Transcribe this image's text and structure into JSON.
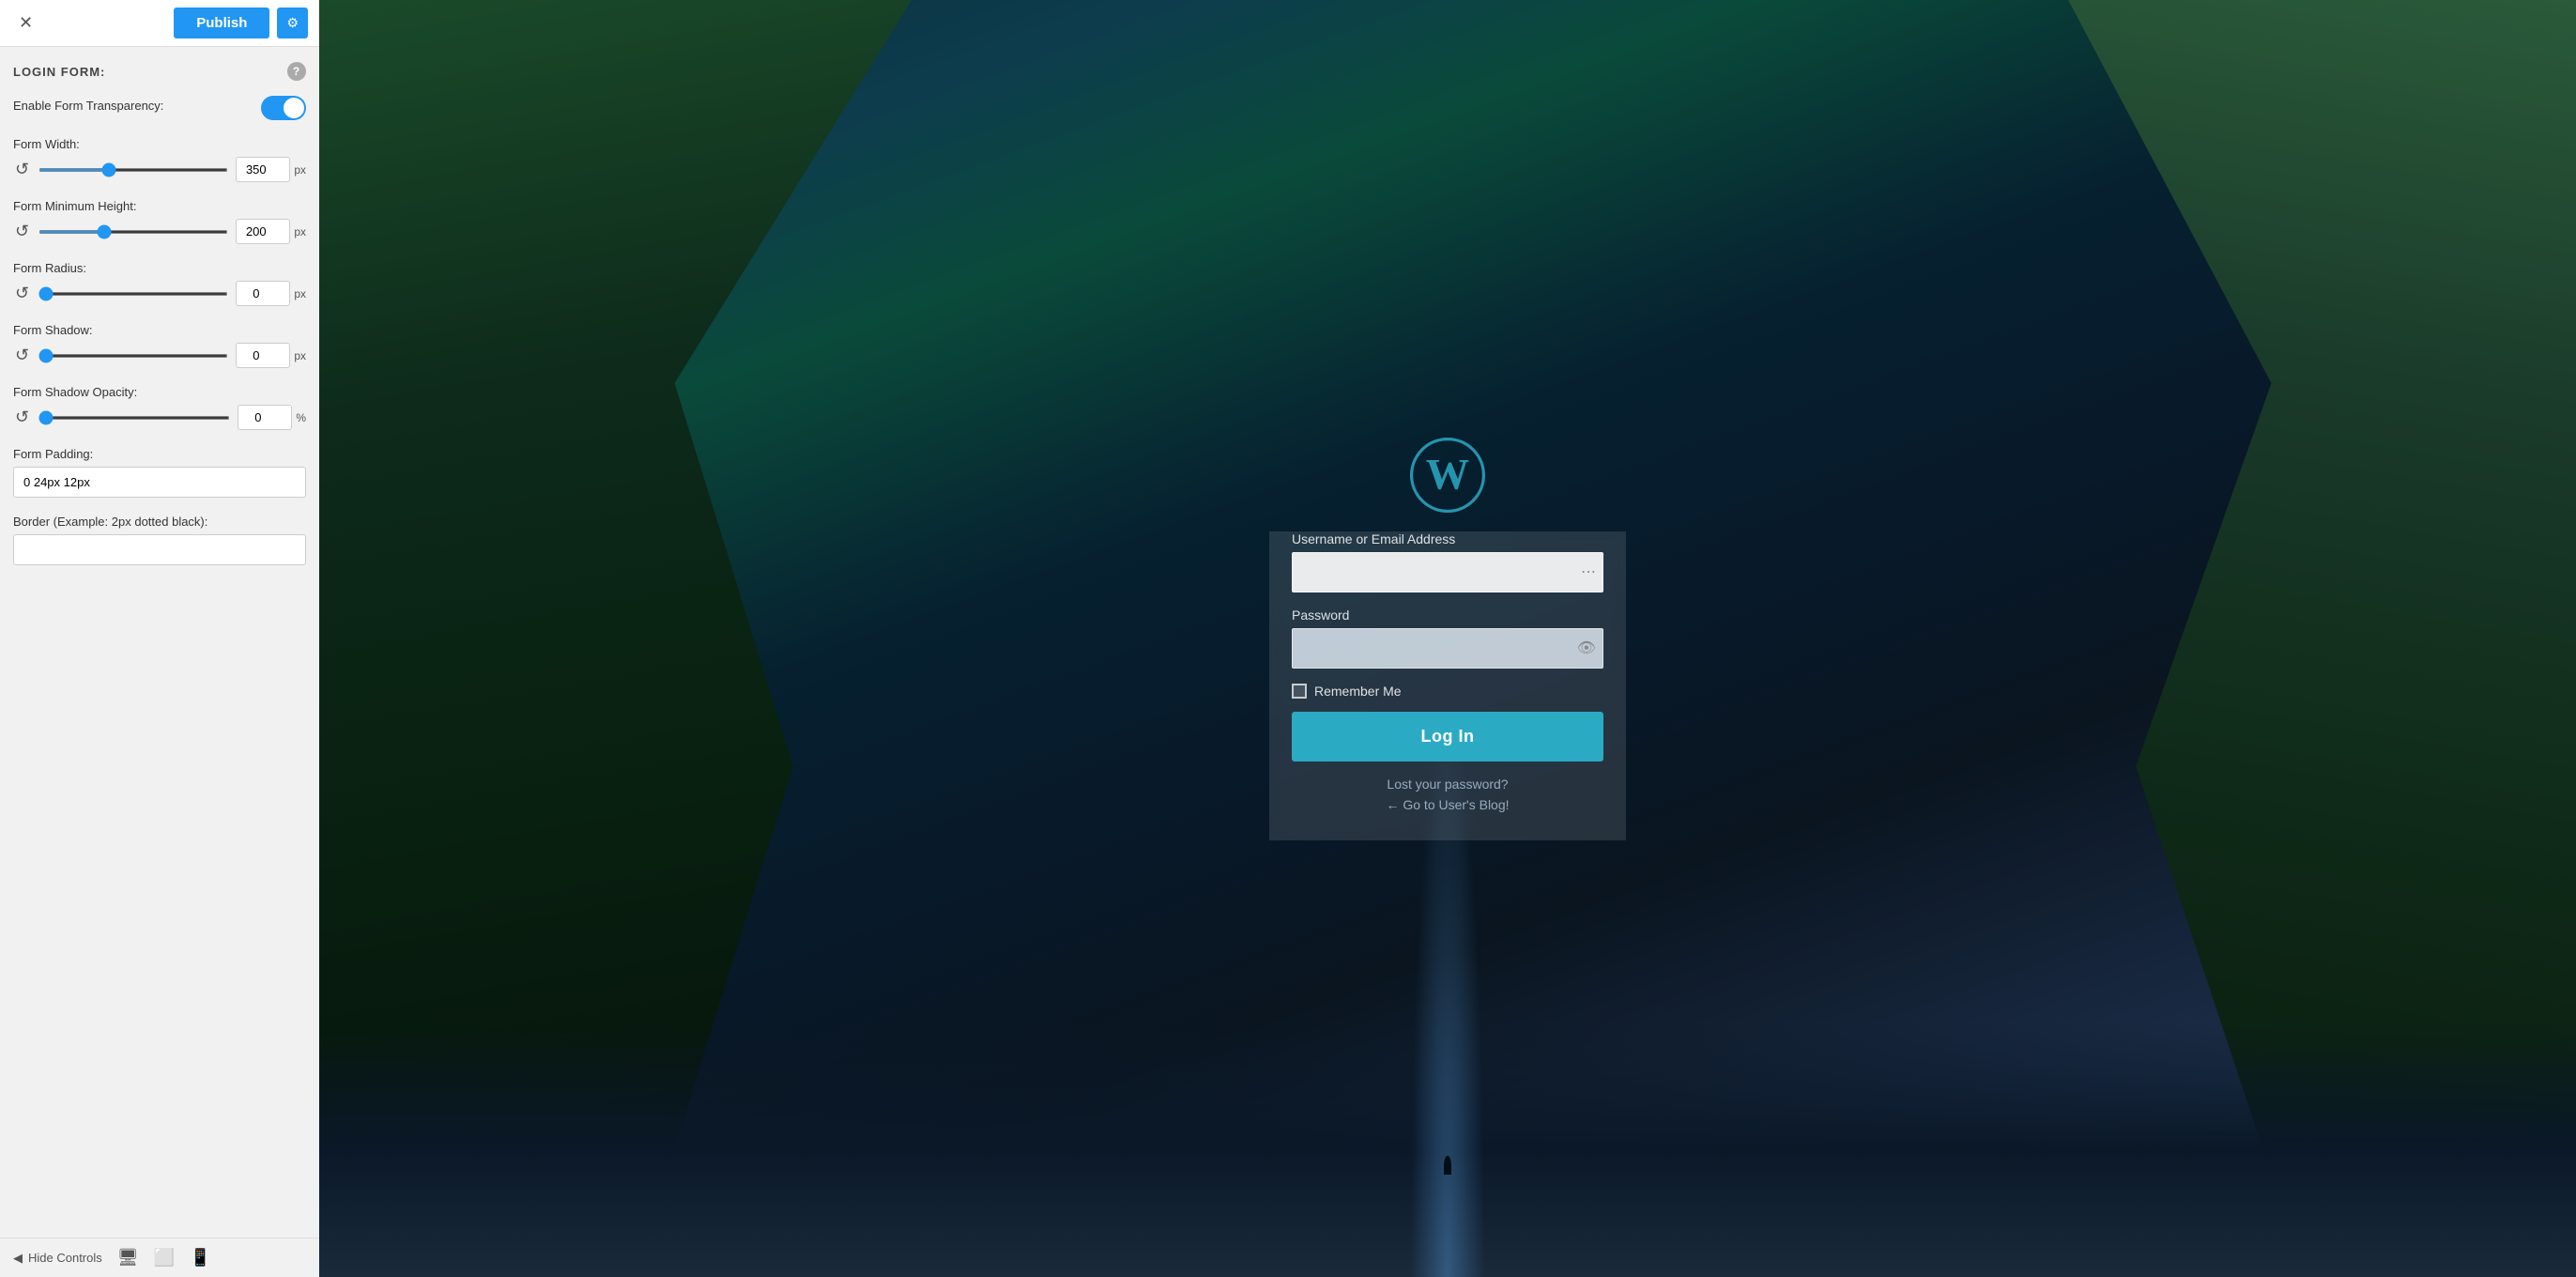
{
  "topbar": {
    "close_label": "✕",
    "publish_label": "Publish",
    "settings_label": "⚙"
  },
  "panel": {
    "section_title": "LOGIN FORM:",
    "help_label": "?",
    "enable_transparency_label": "Enable Form Transparency:",
    "enable_transparency_value": true,
    "form_width_label": "Form Width:",
    "form_width_value": "350",
    "form_width_unit": "px",
    "form_min_height_label": "Form Minimum Height:",
    "form_min_height_value": "200",
    "form_min_height_unit": "px",
    "form_radius_label": "Form Radius:",
    "form_radius_value": "0",
    "form_radius_unit": "px",
    "form_shadow_label": "Form Shadow:",
    "form_shadow_value": "0",
    "form_shadow_unit": "px",
    "form_shadow_opacity_label": "Form Shadow Opacity:",
    "form_shadow_opacity_value": "0",
    "form_shadow_opacity_unit": "%",
    "form_padding_label": "Form Padding:",
    "form_padding_value": "0 24px 12px",
    "border_label": "Border (Example: 2px dotted black):",
    "border_value": ""
  },
  "bottombar": {
    "hide_controls_label": "Hide Controls",
    "desktop_icon": "🖥",
    "tablet_icon": "📱",
    "mobile_icon": "📱"
  },
  "loginform": {
    "username_label": "Username or Email Address",
    "username_placeholder": "",
    "password_label": "Password",
    "password_placeholder": "",
    "remember_label": "Remember Me",
    "login_button": "Log In",
    "lost_password_link": "Lost your password?",
    "goto_blog_link": "← Go to User's Blog!"
  }
}
